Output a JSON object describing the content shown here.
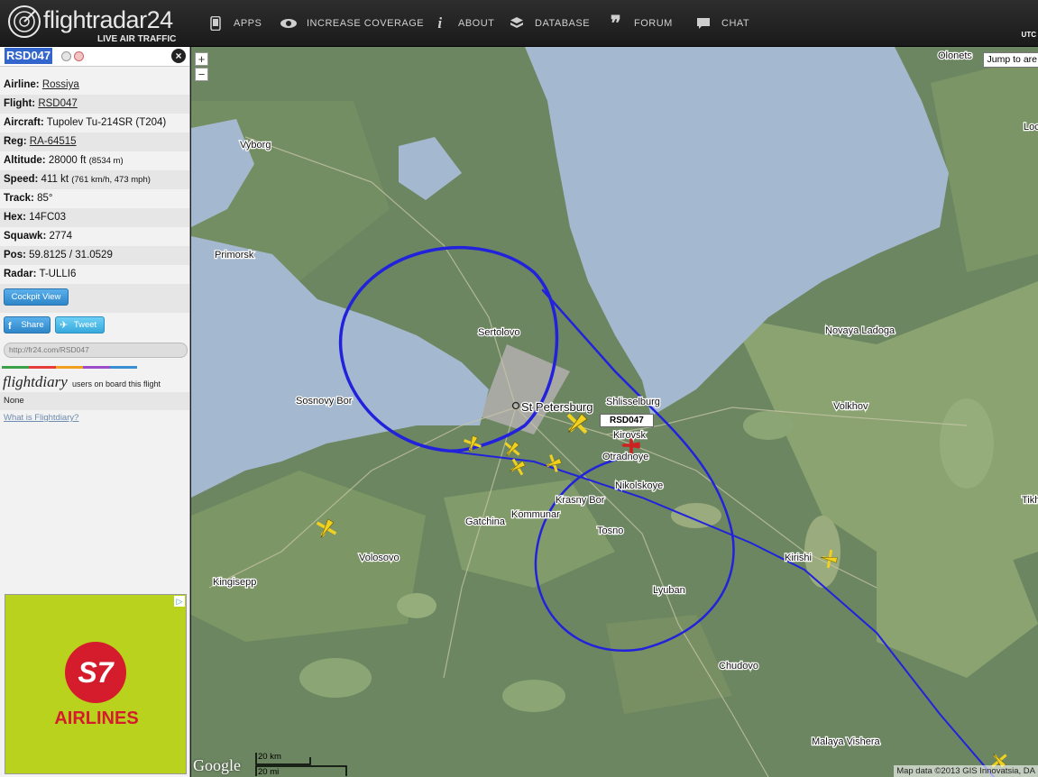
{
  "header": {
    "brand": "flightradar24",
    "tagline": "LIVE AIR TRAFFIC",
    "nav": [
      {
        "label": "APPS",
        "icon": "phone-icon"
      },
      {
        "label": "INCREASE COVERAGE",
        "icon": "eye-icon"
      },
      {
        "label": "ABOUT",
        "icon": "info-icon"
      },
      {
        "label": "DATABASE",
        "icon": "database-icon"
      },
      {
        "label": "FORUM",
        "icon": "quote-icon"
      },
      {
        "label": "CHAT",
        "icon": "chat-icon"
      }
    ],
    "utc": "UTC"
  },
  "sidebar": {
    "callsign": "RSD047",
    "details": [
      {
        "key": "Airline:",
        "value": "Rossiya",
        "link": true
      },
      {
        "key": "Flight:",
        "value": "RSD047",
        "link": true
      },
      {
        "key": "Aircraft:",
        "value": "Tupolev Tu-214SR (T204)",
        "link": false
      },
      {
        "key": "Reg:",
        "value": "RA-64515",
        "link": true
      },
      {
        "key": "Altitude:",
        "value": "28000 ft",
        "extra": "(8534 m)",
        "link": false
      },
      {
        "key": "Speed:",
        "value": "411 kt",
        "extra": "(761 km/h, 473 mph)",
        "link": false
      },
      {
        "key": "Track:",
        "value": "85°",
        "link": false
      },
      {
        "key": "Hex:",
        "value": "14FC03",
        "link": false
      },
      {
        "key": "Squawk:",
        "value": "2774",
        "link": false
      },
      {
        "key": "Pos:",
        "value": "59.8125 / 31.0529",
        "link": false
      },
      {
        "key": "Radar:",
        "value": "T-ULLI6",
        "link": false
      }
    ],
    "cockpit_button": "Cockpit View",
    "share_button": "Share",
    "tweet_button": "Tweet",
    "url": "http://fr24.com/RSD047",
    "flightdiary_logo": "flightdiary",
    "flightdiary_text": "users on board this flight",
    "flightdiary_value": "None",
    "flightdiary_link": "What is Flightdiary?"
  },
  "ad": {
    "brand_mark": "S7",
    "brand_text": "AIRLINES",
    "color": "#b9d21e",
    "accent": "#d41c2c"
  },
  "map": {
    "zoom_in": "+",
    "zoom_out": "−",
    "jump_label": "Jump to are",
    "selected_label": "RSD047",
    "attribution": "Map data ©2013 GIS Innovatsia, DA",
    "google": "Google",
    "scale_km": "20 km",
    "scale_mi": "20 mi",
    "places": [
      "Vyborg",
      "Primorsk",
      "Sertolovo",
      "St Petersburg",
      "Shlisselburg",
      "Kirovsk",
      "Otradnoye",
      "Nikolskoye",
      "Krasny Bor",
      "Kommunar",
      "Gatchina",
      "Tosno",
      "Lyuban",
      "Sosnovy Bor",
      "Volosovo",
      "Kingisepp",
      "Novaya Ladoga",
      "Volkhov",
      "Kirishi",
      "Chudovo",
      "Malaya Vishera",
      "Olonets",
      "Tikh",
      "Loc"
    ],
    "track_color": "#2222dd",
    "water_color": "#a4b8cf"
  }
}
